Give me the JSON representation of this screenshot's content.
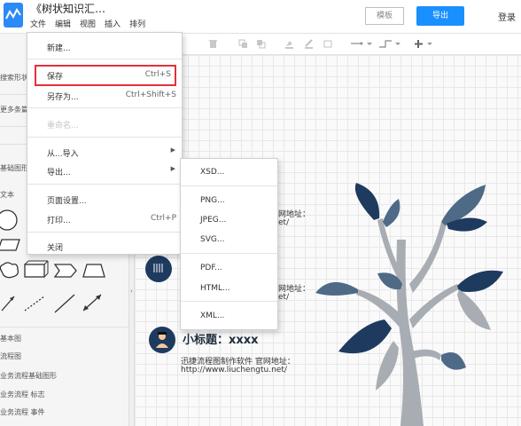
{
  "app": {
    "doc_title": "《树状知识汇…",
    "menu": [
      "文件",
      "编辑",
      "视图",
      "插入",
      "排列"
    ],
    "buttons": {
      "template": "模板",
      "export": "导出",
      "login": "登录"
    }
  },
  "sidebar": {
    "search_placeholder": "搜索形状",
    "more_shapes": "更多条篇",
    "basic_shapes": "基础图形",
    "text_label": "文本",
    "categories": [
      "基本图",
      "流程图",
      "业务流程基础图形",
      "业务流程 标志",
      "业务流程 事件"
    ]
  },
  "file_menu": {
    "items": [
      {
        "label": "新建...",
        "shortcut": "",
        "submenu": false,
        "disabled": false
      },
      {
        "label": "保存",
        "shortcut": "Ctrl+S",
        "submenu": false,
        "disabled": false,
        "highlighted": true
      },
      {
        "label": "另存为...",
        "shortcut": "Ctrl+Shift+S",
        "submenu": false,
        "disabled": false
      },
      {
        "label": "重命名...",
        "shortcut": "",
        "submenu": false,
        "disabled": true
      },
      {
        "label": "从...导入",
        "shortcut": "",
        "submenu": true,
        "disabled": false
      },
      {
        "label": "导出...",
        "shortcut": "",
        "submenu": true,
        "disabled": false
      },
      {
        "label": "页面设置...",
        "shortcut": "",
        "submenu": false,
        "disabled": false
      },
      {
        "label": "打印...",
        "shortcut": "Ctrl+P",
        "submenu": false,
        "disabled": false
      },
      {
        "label": "关闭",
        "shortcut": "",
        "submenu": false,
        "disabled": false
      }
    ]
  },
  "export_submenu": {
    "items": [
      "XSD...",
      "PNG...",
      "JPEG...",
      "SVG...",
      "PDF...",
      "HTML...",
      "XML..."
    ]
  },
  "canvas": {
    "url_label_1": "网地址：",
    "url_tail_1": "et/",
    "url_label_2": "网地址：",
    "url_tail_2": "et/",
    "subtitle": "小标题：xxxx",
    "desc": "迅捷流程图制作软件 官网地址：",
    "url": "http://www.liuchengtu.net/"
  },
  "colors": {
    "accent": "#1a90ff",
    "logo": "#2a8af6",
    "highlight_border": "#e0323a",
    "leaf_dark": "#1e3a5f",
    "leaf_light": "#4e6a86",
    "trunk": "#a7adb3"
  }
}
